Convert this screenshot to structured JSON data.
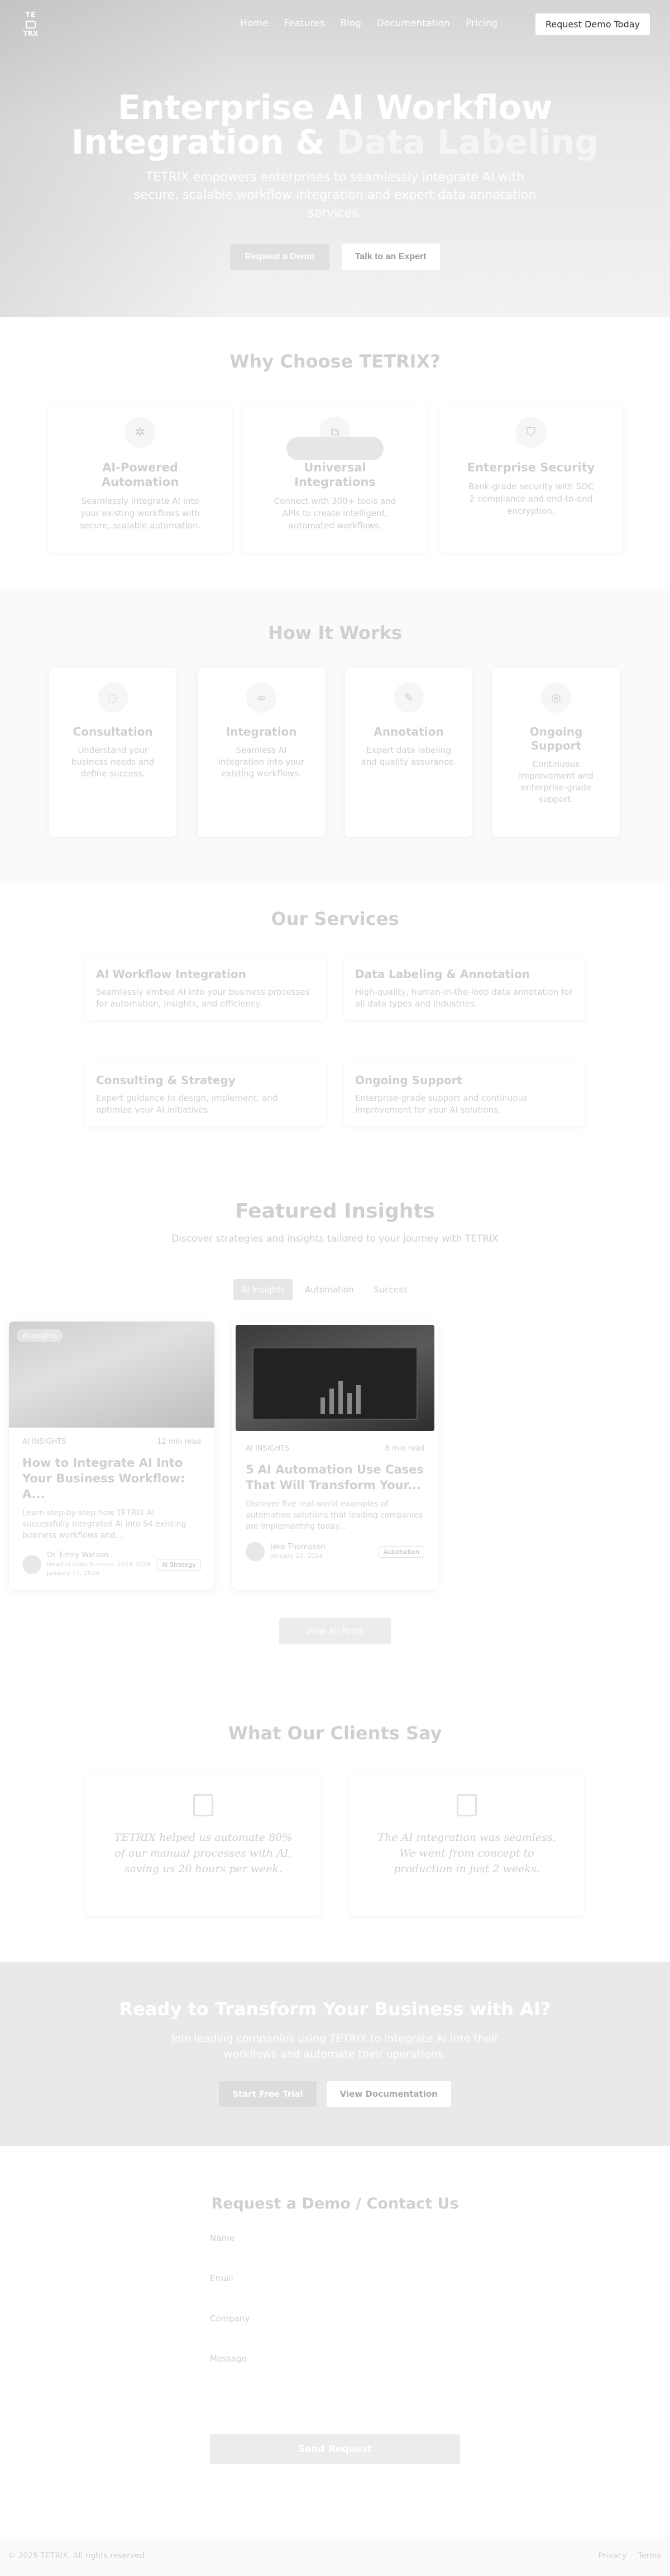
{
  "nav": {
    "logo_top": "TE",
    "logo_bottom": "TRX",
    "links": [
      "Home",
      "Features",
      "Blog",
      "Documentation",
      "Pricing"
    ],
    "cta": "Request Demo Today"
  },
  "hero": {
    "title_line1": "Enterprise AI Workflow",
    "title_line2_a": "Integration & ",
    "title_line2_b": "Data Labeling",
    "subtitle": "TETRIX empowers enterprises to seamlessly integrate AI with secure, scalable workflow integration and expert data annotation services.",
    "btn_primary": "Request a Demo",
    "btn_secondary": "Talk to an Expert"
  },
  "why": {
    "title": "Why Choose TETRIX?",
    "cards": [
      {
        "title": "AI-Powered Automation",
        "text": "Seamlessly integrate AI into your existing workflows with secure, scalable automation.",
        "icon": "gear-icon",
        "glyph": "✲"
      },
      {
        "title": "Universal Integrations",
        "text": "Connect with 300+ tools and APIs to create intelligent, automated workflows.",
        "icon": "plug-icon",
        "glyph": "⧉"
      },
      {
        "title": "Enterprise Security",
        "text": "Bank-grade security with SOC 2 compliance and end-to-end encryption.",
        "icon": "shield-icon",
        "glyph": "⛉"
      }
    ]
  },
  "how": {
    "title": "How It Works",
    "steps": [
      {
        "title": "Consultation",
        "text": "Understand your business needs and define success.",
        "icon": "chat-icon",
        "glyph": "◌"
      },
      {
        "title": "Integration",
        "text": "Seamless AI integration into your existing workflows.",
        "icon": "link-icon",
        "glyph": "∞"
      },
      {
        "title": "Annotation",
        "text": "Expert data labeling and quality assurance.",
        "icon": "pencil-icon",
        "glyph": "✎"
      },
      {
        "title": "Ongoing Support",
        "text": "Continuous improvement and enterprise-grade support.",
        "icon": "support-icon",
        "glyph": "◎"
      }
    ]
  },
  "services": {
    "title": "Our Services",
    "items": [
      {
        "title": "AI Workflow Integration",
        "text": "Seamlessly embed AI into your business processes for automation, insights, and efficiency."
      },
      {
        "title": "Data Labeling & Annotation",
        "text": "High-quality, human-in-the-loop data annotation for all data types and industries."
      },
      {
        "title": "Consulting & Strategy",
        "text": "Expert guidance to design, implement, and optimize your AI initiatives."
      },
      {
        "title": "Ongoing Support",
        "text": "Enterprise-grade support and continuous improvement for your AI solutions."
      }
    ]
  },
  "insights": {
    "title": "Featured Insights",
    "subtitle": "Discover strategies and insights tailored to your journey with TETRIX",
    "tabs": [
      "AI Insights",
      "Automation",
      "Success"
    ],
    "posts": [
      {
        "chip": "AI Insights",
        "category": "AI INSIGHTS",
        "read": "12 min read",
        "title": "How to Integrate AI Into Your Business Workflow: A...",
        "excerpt": "Learn step-by-step how TETRIX AI successfully integrated AI into 54 existing business workflows and...",
        "author": "Dr. Emily Watson",
        "role": "Head of Data Science, 2024-2024",
        "date": "January 15, 2024",
        "badge": "AI Strategy"
      },
      {
        "chip": "",
        "category": "AI INSIGHTS",
        "read": "8 min read",
        "title": "5 AI Automation Use Cases That Will Transform Your...",
        "excerpt": "Discover five real-world examples of automation solutions that leading companies are implementing today...",
        "author": "Jake Thompson",
        "role": "January 10, 2024",
        "date": "",
        "badge": "Automation"
      }
    ],
    "view_all": "View All Posts"
  },
  "testimonials": {
    "title": "What Our Clients Say",
    "quotes": [
      "TETRIX helped us automate 80% of our manual processes with AI, saving us 20 hours per week.",
      "The AI integration was seamless. We went from concept to production in just 2 weeks."
    ]
  },
  "cta": {
    "title": "Ready to Transform Your Business with AI?",
    "text": "Join leading companies using TETRIX to integrate AI into their workflows and automate their operations.",
    "btn_primary": "Start Free Trial",
    "btn_secondary": "View Documentation"
  },
  "contact": {
    "title": "Request a Demo / Contact Us",
    "fields": [
      "Name",
      "Email",
      "Company",
      "Message"
    ],
    "submit": "Send Request"
  },
  "footer": {
    "copyright": "© 2025 TETRIX. All rights reserved.",
    "links": [
      "Privacy",
      "Terms"
    ]
  }
}
